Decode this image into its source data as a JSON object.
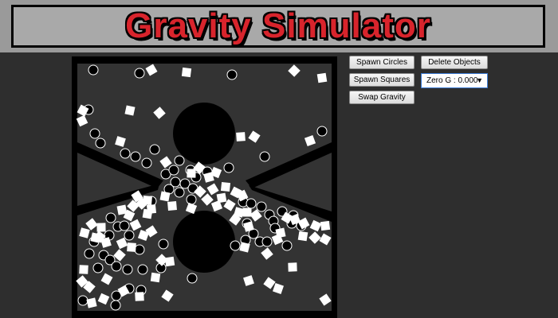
{
  "banner": {
    "title": "Gravity Simulator"
  },
  "controls": {
    "spawn_circles": "Spawn Circles",
    "delete_objects": "Delete Objects",
    "spawn_squares": "Spawn Squares",
    "gravity_mode": "Zero G : 0.000",
    "swap_gravity": "Swap Gravity"
  },
  "icons": {
    "dropdown": "chevron-down-icon"
  },
  "colors": {
    "title": "#d8242c",
    "arena_bg": "#333333",
    "walls": "#000000",
    "bodies_light": "#ffffff",
    "bodies_dark": "#000000"
  }
}
